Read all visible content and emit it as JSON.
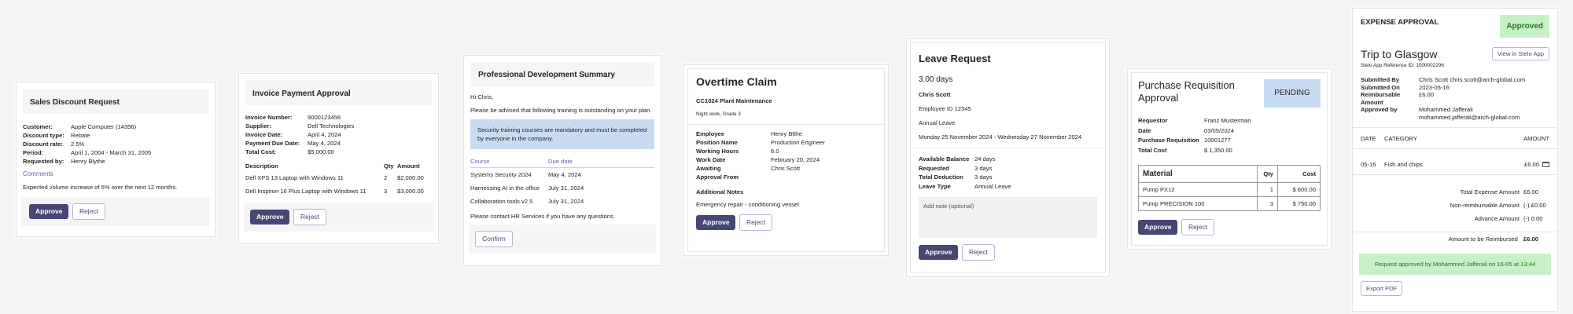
{
  "sales": {
    "title": "Sales Discount Request",
    "fields": [
      {
        "k": "Customer:",
        "v": "Apple Computer (14356)"
      },
      {
        "k": "Discount type:",
        "v": "Rebate"
      },
      {
        "k": "Discount rate:",
        "v": "2.5%"
      },
      {
        "k": "Period:",
        "v": "April 1, 2004 - March 31, 2005"
      },
      {
        "k": "Requested by:",
        "v": "Henry Blythe"
      }
    ],
    "comments": "Comments",
    "note": "Expected volume increase of 5% over the next 12 months.",
    "approve": "Approve",
    "reject": "Reject"
  },
  "invoice": {
    "title": "Invoice Payment Approval",
    "fields": [
      {
        "k": "Invoice Number:",
        "v": "9000123456"
      },
      {
        "k": "Supplier:",
        "v": "Dell Technologies"
      },
      {
        "k": "Invoice Date:",
        "v": "April 4, 2024"
      },
      {
        "k": "Payment Due Date:",
        "v": "May 4, 2024"
      },
      {
        "k": "Total Cost:",
        "v": "$5,000.00"
      }
    ],
    "headers": [
      "Description",
      "Qty",
      "Amount"
    ],
    "rows": [
      [
        "Dell XPS 13 Laptop with Windows 11",
        "2",
        "$2,000.00"
      ],
      [
        "Dell Inspiron 16 Plus Laptop with Windows 11",
        "3",
        "$3,000.00"
      ]
    ],
    "approve": "Approve",
    "reject": "Reject"
  },
  "training": {
    "title": "Professional Development Summary",
    "greeting": "Hi Chris,",
    "intro": "Please be advised that following training is outstanding on your plan.",
    "info": "Security training courses are mandatory and must be completed by everyone in the company.",
    "headers": [
      "Course",
      "Due date"
    ],
    "rows": [
      [
        "Systems Security 2024",
        "May 4, 2024"
      ],
      [
        "Harnessing AI in the office",
        "July 31, 2024"
      ],
      [
        "Collaboration tools v2.5",
        "July 31, 2024"
      ]
    ],
    "contact": "Please contact HR Services if you have any questions.",
    "confirm": "Confirm"
  },
  "overtime": {
    "title": "Overtime Claim",
    "code": "CC1024 Plant Maintenance",
    "sub": "Night work, Grade 3",
    "fields": [
      {
        "k": "Employee",
        "v": "Henry Blthe"
      },
      {
        "k": "Position Name",
        "v": "Production Engineer"
      },
      {
        "k": "Working Hours",
        "v": "6.0"
      },
      {
        "k": "Work Date",
        "v": "February 20, 2024"
      },
      {
        "k": "Awaiting Approval From",
        "v": "Chris Scott"
      }
    ],
    "notes_label": "Additional Notes",
    "notes": "Emergency repair - conditioning vessel",
    "approve": "Approve",
    "reject": "Reject"
  },
  "leave": {
    "title": "Leave Request",
    "days": "3.00 days",
    "name": "Chris Scott",
    "employee_id": "Employee ID 12345",
    "type": "Annual Leave",
    "range": "Monday 25 November 2024 - Wednesday 27 November 2024",
    "fields": [
      {
        "k": "Available Balance",
        "v": "24 days"
      },
      {
        "k": "Requested",
        "v": "3 days"
      },
      {
        "k": "Total Deduction",
        "v": "3 days"
      },
      {
        "k": "Leave Type",
        "v": "Annual Leave"
      }
    ],
    "note_placeholder": "Add note (optional)",
    "approve": "Approve",
    "reject": "Reject"
  },
  "requisition": {
    "title": "Purchase Requisition Approval",
    "status": "PENDING",
    "fields": [
      {
        "k": "Requestor",
        "v": "Franz Musterman"
      },
      {
        "k": "Date",
        "v": "03/05/2024"
      },
      {
        "k": "Purchase Requisition",
        "v": "10001277"
      },
      {
        "k": "Total Cost",
        "v": "$ 1,350.00"
      }
    ],
    "headers": [
      "Material",
      "Qty",
      "Cost"
    ],
    "rows": [
      [
        "Pump PX12",
        "1",
        "$ 600.00"
      ],
      [
        "Pump PRECISION 100",
        "3",
        "$ 750.00"
      ]
    ],
    "approve": "Approve",
    "reject": "Reject"
  },
  "expense": {
    "heading": "EXPENSE APPROVAL",
    "status": "Approved",
    "trip": "Trip to Glasgow",
    "view": "View in Stelo App",
    "ref": "Stelo App Reference ID: 1000002296",
    "fields": [
      {
        "k": "Submitted By",
        "v": "Chris Scott chris.scott@arch-global.com"
      },
      {
        "k": "Submitted On",
        "v": "2023-05-16"
      },
      {
        "k": "Reimbursable Amount",
        "v": "£6.00"
      },
      {
        "k": "Approved by",
        "v": "Mohammed Jafferali mohammed.jafferali@arch-global.com"
      }
    ],
    "col_date": "DATE",
    "col_category": "CATEGORY",
    "col_amount": "AMOUNT",
    "item": {
      "date": "05-16",
      "category": "Fish and chips",
      "amount": "£6.00"
    },
    "totals": [
      {
        "k": "Total Expense Amount",
        "v": "£6.00"
      },
      {
        "k": "Non-reimbursable Amount",
        "v": "(-) £0.00"
      },
      {
        "k": "Advance Amount",
        "v": "(-) 0.00"
      }
    ],
    "reimb_label": "Amount to be Reimbursed",
    "reimb_value": "£6.00",
    "banner": "Request approved by Mohammed Jafferali on 16-05 at 13:44",
    "export": "Export PDF",
    "colors": {
      "approved_bg": "#c8f0c8",
      "approved_text": "#1f7a1f"
    }
  },
  "colors": {
    "brand": "#464775",
    "info": "#c7dcf3",
    "link": "#6264a7"
  }
}
